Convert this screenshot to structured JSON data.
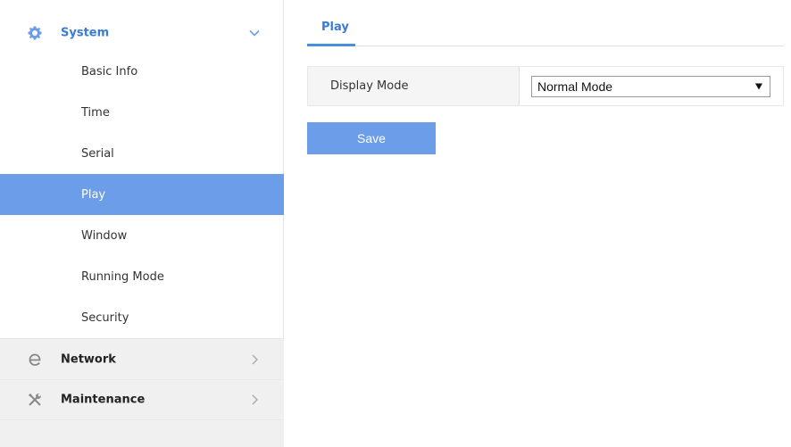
{
  "sidebar": {
    "system": {
      "label": "System",
      "icon": "gear-icon",
      "items": [
        {
          "label": "Basic Info"
        },
        {
          "label": "Time"
        },
        {
          "label": "Serial"
        },
        {
          "label": "Play",
          "active": true
        },
        {
          "label": "Window"
        },
        {
          "label": "Running Mode"
        },
        {
          "label": "Security"
        }
      ]
    },
    "network": {
      "label": "Network",
      "icon": "network-e-icon"
    },
    "maintenance": {
      "label": "Maintenance",
      "icon": "tools-icon"
    }
  },
  "main": {
    "tab": {
      "label": "Play"
    },
    "form": {
      "display_mode": {
        "label": "Display Mode",
        "value": "Normal Mode"
      }
    },
    "save_label": "Save"
  },
  "colors": {
    "accent": "#6b9de8",
    "accent_text": "#3a7bd5",
    "sidebar_group_bg": "#f0f0f0"
  }
}
